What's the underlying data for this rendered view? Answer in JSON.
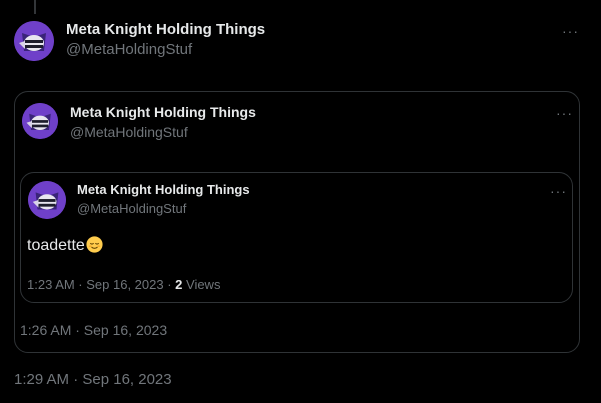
{
  "outer": {
    "display_name": "Meta Knight Holding Things",
    "handle": "@MetaHoldingStuf",
    "timestamp": "1:29 AM · Sep 16, 2023",
    "more_label": "···"
  },
  "quote1": {
    "display_name": "Meta Knight Holding Things",
    "handle": "@MetaHoldingStuf",
    "timestamp": "1:26 AM · Sep 16, 2023",
    "more_label": "···"
  },
  "quote2": {
    "display_name": "Meta Knight Holding Things",
    "handle": "@MetaHoldingStuf",
    "text": "toadette",
    "emoji": "relieved-face-icon",
    "timestamp": "1:23 AM · Sep 16, 2023 · ",
    "views_count": "2",
    "views_label": " Views",
    "more_label": "···"
  },
  "colors": {
    "background": "#000000",
    "text_primary": "#e7e9ea",
    "text_secondary": "#71767b",
    "border": "#2f3336",
    "avatar": "#6f40c9"
  }
}
